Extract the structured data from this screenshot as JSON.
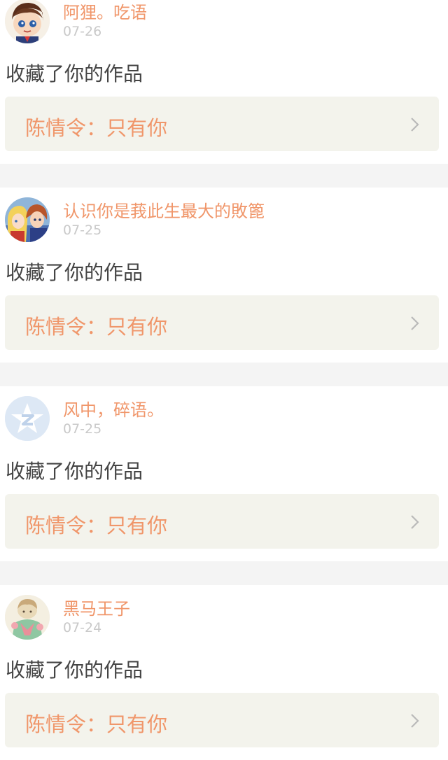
{
  "feed": [
    {
      "name": "阿狸。吃语",
      "time": "07-26",
      "action": "收藏了你的作品",
      "card_title": "陈情令：只有你",
      "avatar": "cartoon-boy-avatar"
    },
    {
      "name": "认识你是莪此生最大的敗篦",
      "time": "07-25",
      "action": "收藏了你的作品",
      "card_title": "陈情令：只有你",
      "avatar": "anime-couple-avatar"
    },
    {
      "name": "风中，碎语。",
      "time": "07-25",
      "action": "收藏了你的作品",
      "card_title": "陈情令：只有你",
      "avatar": "default-star-avatar"
    },
    {
      "name": "黑马王子",
      "time": "07-24",
      "action": "收藏了你的作品",
      "card_title": "陈情令：只有你",
      "avatar": "illustration-girl-avatar"
    }
  ],
  "colors": {
    "name": "#f0966a",
    "time": "#c9c9c9",
    "card_bg": "#f3f3ec",
    "separator": "#f4f4f4"
  }
}
